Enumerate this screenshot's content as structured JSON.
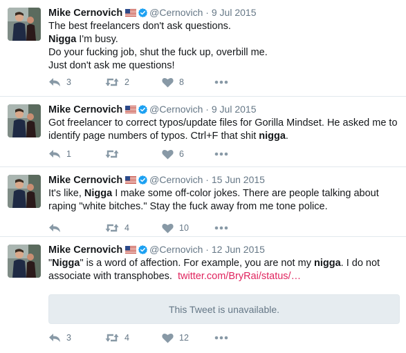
{
  "tweets": [
    {
      "name": "Mike Cernovich",
      "handle": "@Cernovich",
      "separator": "·",
      "date": "9 Jul 2015",
      "lines": [
        {
          "parts": [
            {
              "t": "The best freelancers don't ask questions.",
              "b": false
            }
          ]
        },
        {
          "parts": [
            {
              "t": "Nigga",
              "b": true
            },
            {
              "t": " I'm busy.",
              "b": false
            }
          ]
        },
        {
          "parts": [
            {
              "t": "Do your fucking job, shut the fuck up, overbill me.",
              "b": false
            }
          ]
        },
        {
          "parts": [
            {
              "t": "Just don't ask me questions!",
              "b": false
            }
          ]
        }
      ],
      "reply_count": "3",
      "retweet_count": "2",
      "like_count": "8"
    },
    {
      "name": "Mike Cernovich",
      "handle": "@Cernovich",
      "separator": "·",
      "date": "9 Jul 2015",
      "lines": [
        {
          "parts": [
            {
              "t": "Got freelancer to correct typos/update files for Gorilla Mindset. He asked me to",
              "b": false
            }
          ]
        },
        {
          "parts": [
            {
              "t": "identify page numbers of typos. Ctrl+F that shit ",
              "b": false
            },
            {
              "t": "nigga",
              "b": true
            },
            {
              "t": ".",
              "b": false
            }
          ]
        }
      ],
      "reply_count": "1",
      "retweet_count": "",
      "like_count": "6"
    },
    {
      "name": "Mike Cernovich",
      "handle": "@Cernovich",
      "separator": "·",
      "date": "15 Jun 2015",
      "lines": [
        {
          "parts": [
            {
              "t": "It's like, ",
              "b": false
            },
            {
              "t": "Nigga",
              "b": true
            },
            {
              "t": " I make some off-color jokes. There are people talking about",
              "b": false
            }
          ]
        },
        {
          "parts": [
            {
              "t": "raping \"white bitches.\" Stay the fuck away from me tone police.",
              "b": false
            }
          ]
        }
      ],
      "reply_count": "",
      "retweet_count": "4",
      "like_count": "10"
    },
    {
      "name": "Mike Cernovich",
      "handle": "@Cernovich",
      "separator": "·",
      "date": "12 Jun 2015",
      "lines": [
        {
          "parts": [
            {
              "t": "\"",
              "b": false
            },
            {
              "t": "Nigga",
              "b": true
            },
            {
              "t": "\" is a word of affection. For example, you are not my ",
              "b": false
            },
            {
              "t": "nigga",
              "b": true
            },
            {
              "t": ". I do not",
              "b": false
            }
          ]
        },
        {
          "parts": [
            {
              "t": "associate with transphobes.  ",
              "b": false
            },
            {
              "t": "twitter.com/BryRai/status/…",
              "b": false,
              "link": true
            }
          ]
        }
      ],
      "quoted_unavailable": "This Tweet is unavailable.",
      "reply_count": "3",
      "retweet_count": "4",
      "like_count": "12"
    }
  ],
  "icons": {
    "reply": "reply-icon",
    "retweet": "retweet-icon",
    "like": "heart-icon",
    "more": "more-icon",
    "verified": "verified-badge-icon",
    "flag": "us-flag-icon"
  },
  "colors": {
    "link": "#e0245e",
    "verified": "#1da1f2",
    "icon_gray": "#8899a6",
    "separator": "#e1e8ed",
    "card_bg": "#e6ecf0"
  }
}
